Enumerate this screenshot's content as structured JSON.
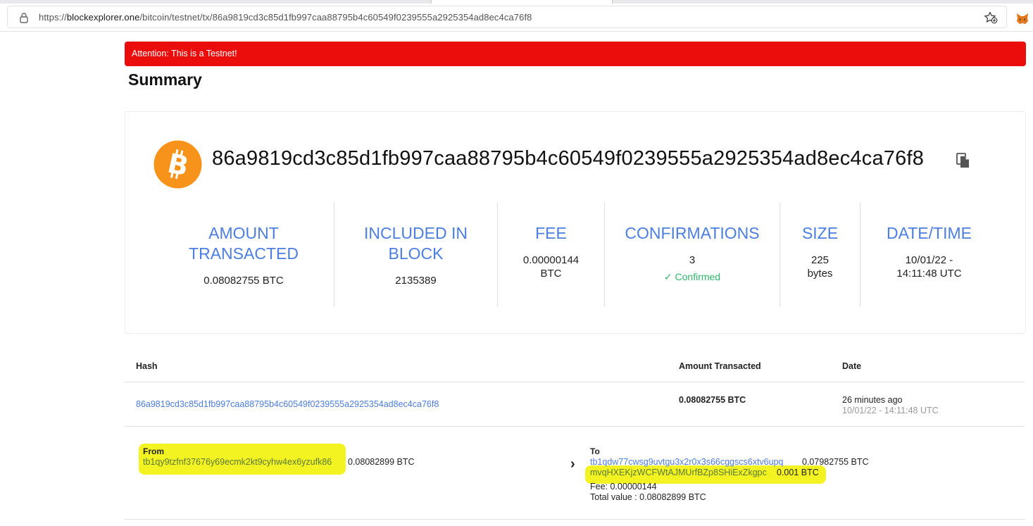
{
  "browser": {
    "url_prefix": "https://",
    "url_host": "blockexplorer.one",
    "url_path": "/bitcoin/testnet/tx/86a9819cd3c85d1fb997caa88795b4c60549f0239555a2925354ad8ec4ca76f8"
  },
  "alert": {
    "text": "Attention: This is a Testnet!"
  },
  "summary": {
    "title": "Summary"
  },
  "tx": {
    "hash": "86a9819cd3c85d1fb997caa88795b4c60549f0239555a2925354ad8ec4ca76f8",
    "stats": [
      {
        "label": "AMOUNT TRANSACTED",
        "value": "0.08082755 BTC"
      },
      {
        "label": "INCLUDED IN BLOCK",
        "value": "2135389"
      },
      {
        "label": "FEE",
        "value": "0.00000144 BTC"
      },
      {
        "label": "CONFIRMATIONS",
        "value": "3",
        "status": "✓ Confirmed"
      },
      {
        "label": "SIZE",
        "value": "225 bytes"
      },
      {
        "label": "DATE/TIME",
        "value": "10/01/22 - 14:11:48 UTC"
      }
    ]
  },
  "table": {
    "headers": {
      "hash": "Hash",
      "amount": "Amount Transacted",
      "date": "Date"
    },
    "row": {
      "hash": "86a9819cd3c85d1fb997caa88795b4c60549f0239555a2925354ad8ec4ca76f8",
      "amount": "0.08082755 BTC",
      "date_relative": "26 minutes ago",
      "date_full": "10/01/22 - 14:11:48 UTC"
    },
    "from": {
      "label": "From",
      "address": "tb1qy9tzfnf37676y69ecmk2kt9cyhw4ex6yzufk86",
      "amount": "0.08082899 BTC"
    },
    "arrow": "›",
    "to": {
      "label": "To",
      "outputs": [
        {
          "address": "tb1qdw77cwsg9uvtgu3x2r0x3s66cggscs6xtv6upq",
          "amount": "0.07982755 BTC"
        },
        {
          "address": "mvqHXEKjzWCFWtAJMUrfBZp8SHiExZkgpc",
          "amount": "0.001 BTC"
        }
      ],
      "fee": "Fee: 0.00000144",
      "total": "Total value : 0.08082899 BTC"
    }
  },
  "colors": {
    "alert": "#eb0c0c",
    "accent": "#4c7de0",
    "bitcoin": "#f7931a",
    "confirmed": "#2fb56a",
    "highlight": "#f3f321"
  }
}
